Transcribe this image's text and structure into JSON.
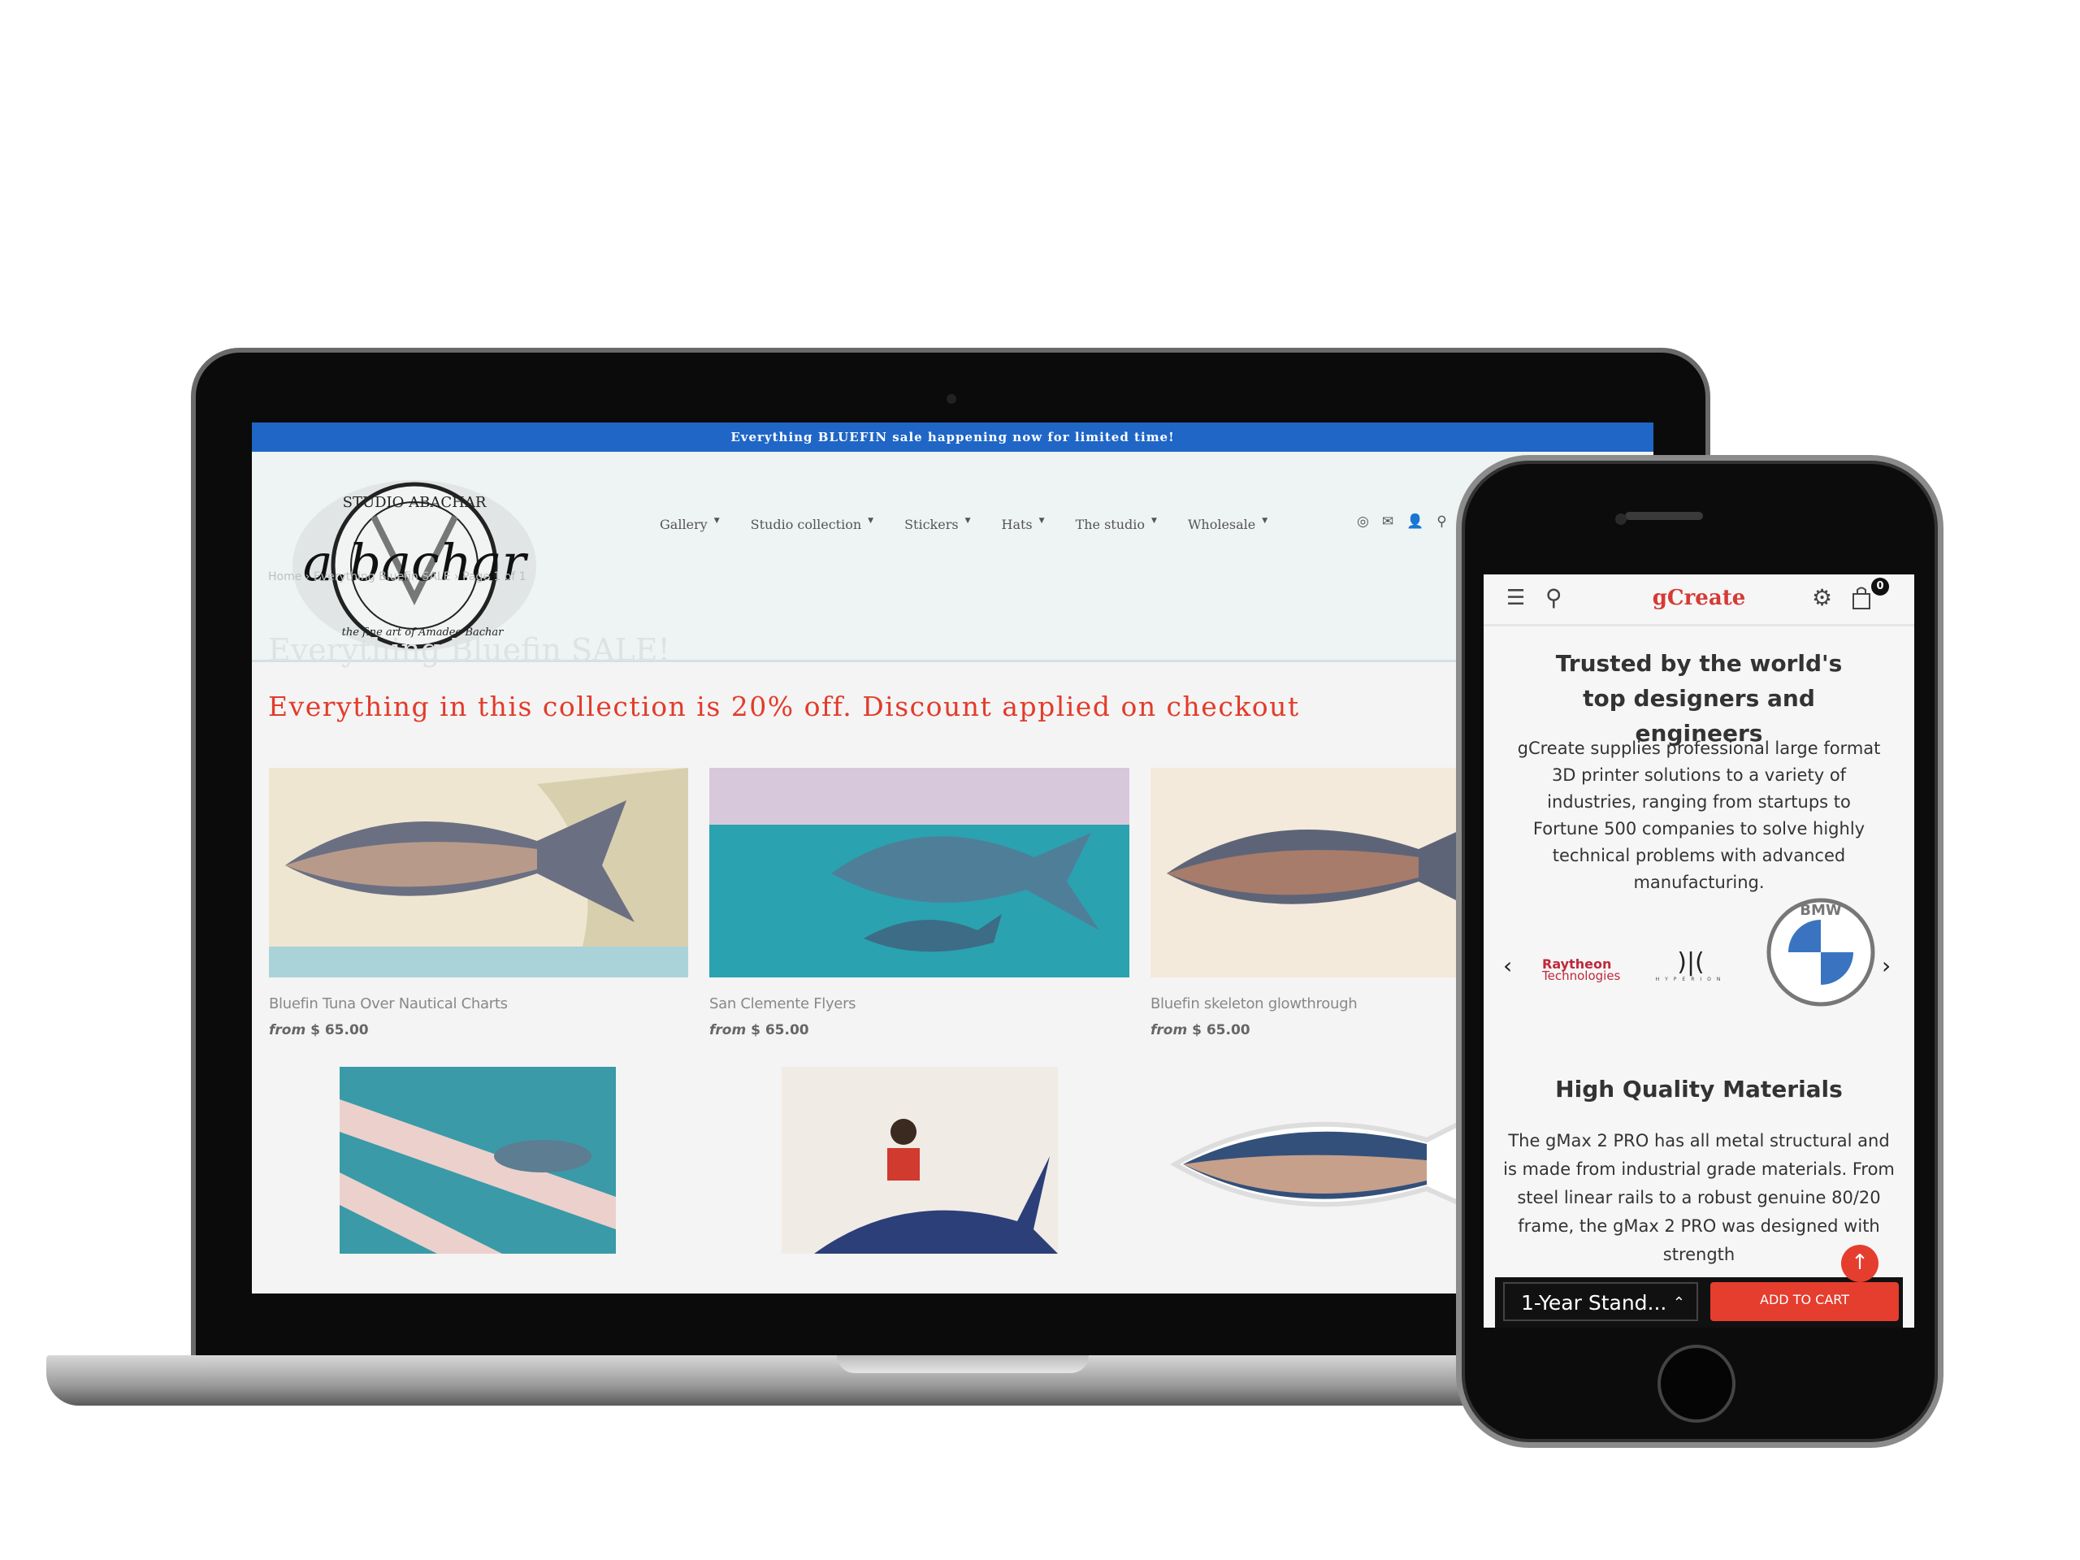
{
  "laptop": {
    "banner": "Everything BLUEFIN sale happening now for limited time!",
    "logo_text": "STUDIO ABACHAR · a.bachar · the fine art of Amadeo Bachar",
    "nav": [
      {
        "label": "Gallery"
      },
      {
        "label": "Studio collection"
      },
      {
        "label": "Stickers"
      },
      {
        "label": "Hats"
      },
      {
        "label": "The studio"
      },
      {
        "label": "Wholesale"
      }
    ],
    "nav_icons": [
      "instagram-icon",
      "mail-icon",
      "user-icon",
      "search-icon"
    ],
    "breadcrumb": "Home  ›  Everything Bluefin SALE  ›  Page 1 of 1",
    "page_title": "Everything Bluefin SALE!",
    "sale_text": "Everything in this collection is 20% off. Discount applied on checkout",
    "products": [
      {
        "name": "Bluefin Tuna Over Nautical Charts",
        "from": "from",
        "price": "$ 65.00"
      },
      {
        "name": "San Clemente Flyers",
        "from": "from",
        "price": "$ 65.00"
      },
      {
        "name": "Bluefin skeleton glowthrough",
        "from": "from",
        "price": "$ 65.00"
      }
    ],
    "accent": "#1f66c6",
    "sale_color": "#e33b2a"
  },
  "phone": {
    "brand": "gCreate",
    "cart_count": "0",
    "heading1": "Trusted by the world's top designers and engineers",
    "para1": "gCreate supplies professional large format 3D printer solutions to a variety of industries, ranging from startups to Fortune 500 companies to solve highly technical problems with advanced manufacturing.",
    "logos": {
      "raytheon1": "Raytheon",
      "raytheon2": "Technologies",
      "hyperion": "HYPERION",
      "bmw": "BMW"
    },
    "heading2": "High Quality Materials",
    "para2": "The gMax 2 PRO has all metal structural and is made from industrial grade materials. From steel linear rails to a robust genuine 80/20 frame, the gMax 2 PRO was designed with strength",
    "plan_select": "1-Year Stand...",
    "add_to_cart": "ADD TO CART",
    "accent": "#e53d2e"
  }
}
